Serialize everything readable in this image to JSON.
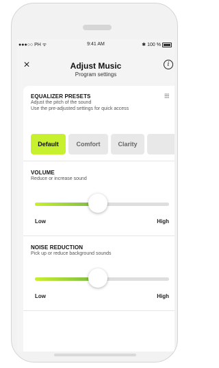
{
  "status_bar": {
    "carrier": "●●●○○ PH ᯤ",
    "time": "9:41 AM",
    "bluetooth": "✱",
    "battery": "100 %"
  },
  "header": {
    "close_icon": "×",
    "title": "Adjust Music",
    "subtitle": "Program settings",
    "info_icon": "i"
  },
  "equalizer": {
    "title": "EQUALIZER PRESETS",
    "description": "Adjust the pitch of the sound\nUse the pre-adjusted settings for quick access",
    "settings_icon": "⫶⫶⫶",
    "presets": [
      {
        "label": "Default",
        "active": true
      },
      {
        "label": "Comfort",
        "active": false
      },
      {
        "label": "Clarity",
        "active": false
      },
      {
        "label": "",
        "active": false
      }
    ]
  },
  "volume": {
    "title": "VOLUME",
    "description": "Reduce or increase sound",
    "level_percent": 47,
    "low_label": "Low",
    "high_label": "High"
  },
  "noise_reduction": {
    "title": "NOISE REDUCTION",
    "description": "Pick up or reduce background sounds",
    "level_percent": 47,
    "low_label": "Low",
    "high_label": "High"
  },
  "colors": {
    "accent": "#c7f02e",
    "accent_dark": "#7bb84a",
    "track": "#dedede"
  }
}
